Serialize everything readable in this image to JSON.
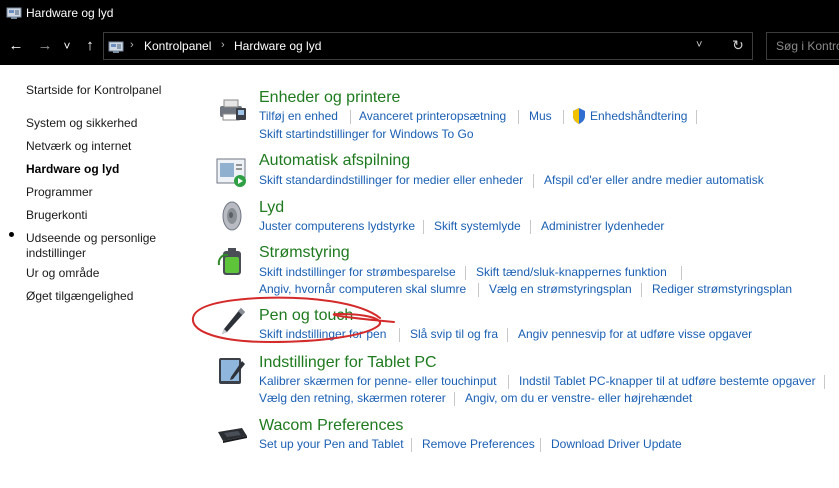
{
  "window": {
    "title": "Hardware og lyd",
    "icon": "control-panel-icon"
  },
  "navigation": {
    "back_icon": "←",
    "forward_icon": "→",
    "recent_icon": "˅",
    "up_icon": "↑",
    "breadcrumbs": [
      "Kontrolpanel",
      "Hardware og lyd"
    ],
    "separator": "›",
    "dropdown_icon": "˅",
    "refresh_icon": "↻",
    "search_placeholder": "Søg i Kontrolpanel"
  },
  "sidebar": {
    "home": "Startside for Kontrolpanel",
    "items": [
      {
        "label": "System og sikkerhed",
        "current": false
      },
      {
        "label": "Netværk og internet",
        "current": false
      },
      {
        "label": "Hardware og lyd",
        "current": true
      },
      {
        "label": "Programmer",
        "current": false
      },
      {
        "label": "Brugerkonti",
        "current": false
      },
      {
        "label": "Udseende og personlige",
        "current": false
      },
      {
        "label": "indstillinger",
        "current": false
      },
      {
        "label": "Ur  og område",
        "current": false
      },
      {
        "label": "Øget tilgængelighed",
        "current": false
      }
    ]
  },
  "categories": [
    {
      "title": "Enheder og printere",
      "icon": "printer-icon",
      "links": [
        "Tilføj en enhed",
        "Avanceret printeropsætning",
        "Mus",
        "Enhedshåndtering",
        "Skift startindstillinger for Windows To Go"
      ]
    },
    {
      "title": "Automatisk afspilning",
      "icon": "autoplay-icon",
      "links": [
        "Skift standardindstillinger for medier eller enheder",
        "Afspil cd'er eller andre medier automatisk"
      ]
    },
    {
      "title": "Lyd",
      "icon": "speaker-icon",
      "links": [
        "Juster computerens lydstyrke",
        "Skift systemlyde",
        "Administrer lydenheder"
      ]
    },
    {
      "title": "Strømstyring",
      "icon": "battery-icon",
      "links": [
        "Skift indstillinger for strømbesparelse",
        "Skift tænd/sluk-knappernes funktion",
        "Angiv, hvornår computeren skal slumre",
        "Vælg en strømstyringsplan",
        "Rediger strømstyringsplan"
      ]
    },
    {
      "title": "Pen og touch",
      "icon": "pen-icon",
      "links": [
        "Skift indstillinger for pen",
        "Slå svip til og fra",
        "Angiv pennesvip for at udføre visse opgaver"
      ]
    },
    {
      "title": "Indstillinger for Tablet PC",
      "icon": "tablet-icon",
      "links": [
        "Kalibrer skærmen for penne- eller touchinput",
        "Indstil Tablet PC-knapper til at udføre bestemte opgaver",
        "Vælg den retning, skærmen roterer",
        "Angiv, om du er venstre- eller højrehændet"
      ]
    },
    {
      "title": "Wacom Preferences",
      "icon": "wacom-tablet-icon",
      "links": [
        "Set up your Pen and Tablet",
        "Remove Preferences",
        "Download Driver Update"
      ]
    }
  ],
  "colors": {
    "category_title": "#1e7a1e",
    "link": "#1a5fb4",
    "chrome": "#000000",
    "annotation": "#d42a2a"
  }
}
